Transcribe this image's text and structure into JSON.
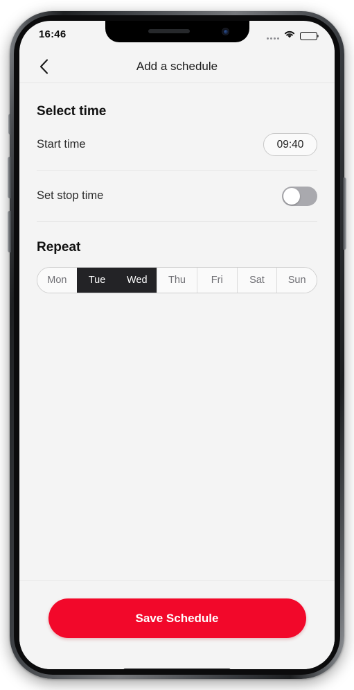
{
  "status_bar": {
    "time": "16:46",
    "signal_icon": "signal-dots-icon",
    "wifi_icon": "wifi-icon",
    "battery_icon": "battery-icon"
  },
  "header": {
    "back_icon": "chevron-left-icon",
    "title": "Add a schedule"
  },
  "sections": {
    "select_time": {
      "title": "Select time",
      "rows": [
        {
          "label": "Start time",
          "value": "09:40",
          "control": "time-pill"
        },
        {
          "label": "Set stop time",
          "control": "toggle",
          "enabled": false
        }
      ]
    },
    "repeat": {
      "title": "Repeat",
      "days": [
        {
          "label": "Mon",
          "selected": false
        },
        {
          "label": "Tue",
          "selected": true
        },
        {
          "label": "Wed",
          "selected": true
        },
        {
          "label": "Thu",
          "selected": false
        },
        {
          "label": "Fri",
          "selected": false
        },
        {
          "label": "Sat",
          "selected": false
        },
        {
          "label": "Sun",
          "selected": false
        }
      ]
    }
  },
  "footer": {
    "save_label": "Save Schedule"
  },
  "colors": {
    "accent_red": "#f2082a",
    "selected_day": "#232326",
    "screen_bg": "#f4f4f4",
    "toggle_off": "#a9a9ae"
  }
}
